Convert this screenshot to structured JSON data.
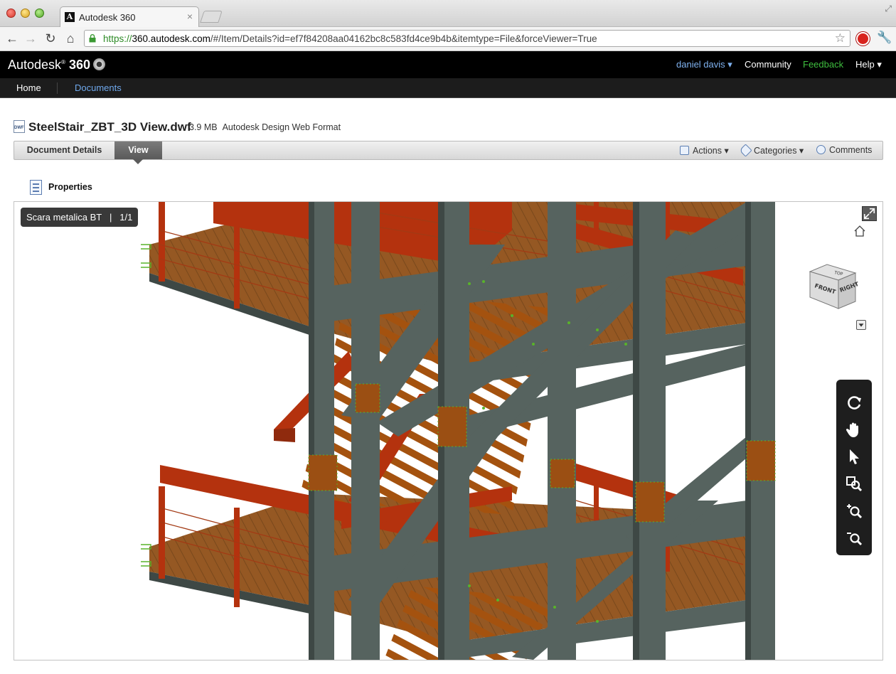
{
  "browser": {
    "tab_title": "Autodesk 360",
    "tab_close": "×",
    "tab_favicon": "A",
    "url_scheme": "https://",
    "url_host": "360.autodesk.com",
    "url_path": "/#/Item/Details?id=ef7f84208aa04162bc8c583fd4ce9b4b&itemtype=File&forceViewer=True",
    "icons": [
      "back-icon",
      "forward-icon",
      "reload-icon",
      "home-icon",
      "lock-icon",
      "star-icon",
      "stop-extension-icon",
      "wrench-icon"
    ]
  },
  "header": {
    "brand_text": "Autodesk",
    "brand_num": "360",
    "user": "daniel davis",
    "community": "Community",
    "feedback": "Feedback",
    "help": "Help"
  },
  "subnav": {
    "home": "Home",
    "documents": "Documents"
  },
  "document": {
    "icon_label": "DWF",
    "title": "SteelStair_ZBT_3D View.dwf",
    "size": "3.9 MB",
    "format": "Autodesk Design Web Format"
  },
  "tabs": {
    "details": "Document Details",
    "view": "View"
  },
  "actions": {
    "actions": "Actions",
    "categories": "Categories",
    "comments": "Comments"
  },
  "properties": {
    "label": "Properties"
  },
  "viewer": {
    "sheet_name": "Scara metalica BT",
    "sheet_page": "1/1",
    "cube_front": "FRONT",
    "cube_right": "RIGHT",
    "cube_top": "TOP",
    "tools": [
      "orbit-icon",
      "pan-icon",
      "select-icon",
      "zoom-window-icon",
      "zoom-in-icon",
      "zoom-out-icon"
    ]
  },
  "colors": {
    "steel": "#56635f",
    "steel_dark": "#3e4845",
    "rust": "#b4320e",
    "deck": "#8c4a10",
    "bolt_green": "#59b32a",
    "link_blue": "#6fa8ec",
    "feedback_green": "#3fbf3f"
  }
}
